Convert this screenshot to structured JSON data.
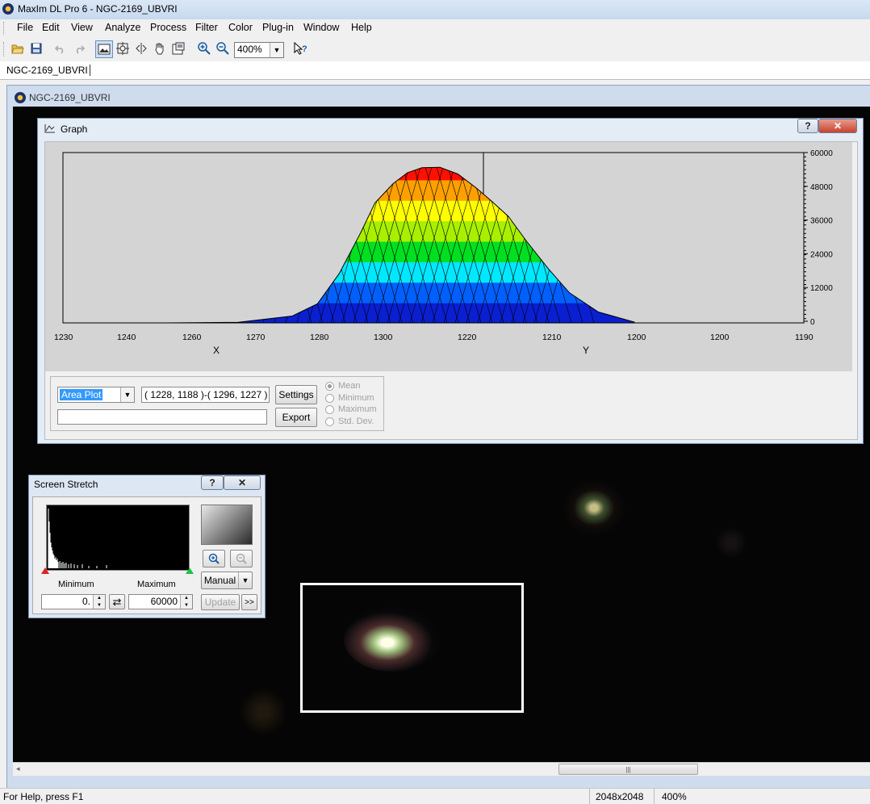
{
  "window": {
    "title": "MaxIm DL Pro 6 - NGC-2169_UBVRI"
  },
  "menu": [
    {
      "label": "File",
      "key": "F"
    },
    {
      "label": "Edit",
      "key": "E"
    },
    {
      "label": "View",
      "key": "V"
    },
    {
      "label": "Analyze",
      "key": "A"
    },
    {
      "label": "Process",
      "key": "P"
    },
    {
      "label": "Filter",
      "key": "t"
    },
    {
      "label": "Color",
      "key": "C"
    },
    {
      "label": "Plug-in",
      "key": "u"
    },
    {
      "label": "Window",
      "key": "W"
    },
    {
      "label": "Help",
      "key": "H"
    }
  ],
  "toolbar": {
    "icons": [
      "open-folder-icon",
      "save-icon",
      "undo-icon",
      "redo-icon",
      "image-mode-icon",
      "crosshair-icon",
      "split-icon",
      "hand-icon",
      "info-icon",
      "zoom-in-icon",
      "zoom-out-icon",
      "context-help-icon"
    ],
    "zoom_value": "400%"
  },
  "doc_tab": {
    "label": "NGC-2169_UBVRI"
  },
  "child_window": {
    "title": "NGC-2169_UBVRI"
  },
  "graph": {
    "title": "Graph",
    "help": "?",
    "close": "✕",
    "plot_type": "Area Plot",
    "coords": "( 1228, 1188 )-( 1296, 1227 )",
    "settings": "Settings",
    "export": "Export",
    "status_field": "",
    "radios": [
      {
        "label": "Mean",
        "checked": true
      },
      {
        "label": "Minimum",
        "checked": false
      },
      {
        "label": "Maximum",
        "checked": false
      },
      {
        "label": "Std. Dev.",
        "checked": false
      }
    ]
  },
  "chart_data": {
    "type": "area",
    "title": "",
    "x_ticks": [
      "1230",
      "1240",
      "1260",
      "1270",
      "1280",
      "1300",
      "1220",
      "1210",
      "1200",
      "1200",
      "1190"
    ],
    "y_ticks": [
      "60000",
      "48000",
      "36000",
      "24000",
      "12000",
      "0"
    ],
    "xlabel": "X",
    "ylabel": "Y",
    "ylim": [
      0,
      60000
    ],
    "profile_ridge": {
      "x": [
        1230,
        1250,
        1265,
        1272,
        1278,
        1284,
        1288,
        1293,
        1297,
        1301,
        1306,
        1311,
        1316,
        1320,
        1325,
        1330,
        1336,
        1342,
        1350,
        1360
      ],
      "values": [
        0,
        200,
        2500,
        7000,
        18000,
        33000,
        44000,
        51000,
        55000,
        56800,
        57000,
        54500,
        49500,
        45000,
        39000,
        30000,
        20000,
        11000,
        4000,
        300
      ]
    },
    "colors": [
      "#0a1fd0",
      "#0060ff",
      "#00e8ff",
      "#00e020",
      "#a8f000",
      "#ffff00",
      "#ffa000",
      "#ff1000"
    ]
  },
  "stretch": {
    "title": "Screen Stretch",
    "help": "?",
    "close": "✕",
    "min_label": "Minimum",
    "max_label": "Maximum",
    "min_value": "0.",
    "max_value": "60000",
    "swap": "⇄",
    "mode": "Manual",
    "update": "Update",
    "more": ">>"
  },
  "status": {
    "help": "For Help, press F1",
    "size": "2048x2048",
    "zoom": "400%"
  }
}
